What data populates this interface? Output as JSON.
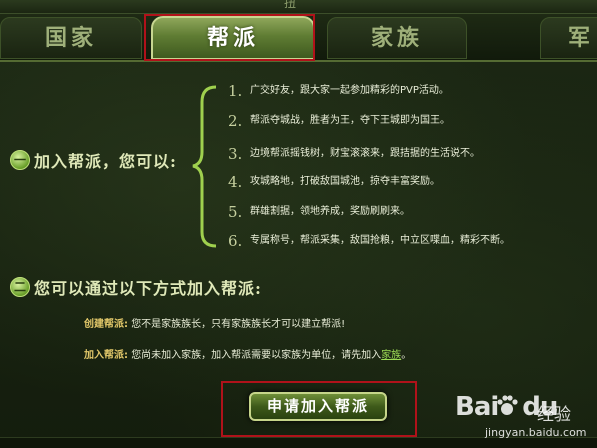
{
  "window": {
    "title": "扭"
  },
  "tabs": [
    {
      "label": "国家",
      "active": false
    },
    {
      "label": "帮派",
      "active": true
    },
    {
      "label": "家族",
      "active": false
    },
    {
      "label": "军",
      "active": false
    }
  ],
  "section1": {
    "title": "加入帮派，您可以:",
    "items": [
      {
        "num": "1.",
        "text": "广交好友，跟大家一起参加精彩的PVP活动。"
      },
      {
        "num": "2.",
        "text": "帮派夺城战，胜者为王，夺下王城即为国王。"
      },
      {
        "num": "3.",
        "text": "边境帮派摇钱树，财宝滚滚来，跟拮据的生活说不。"
      },
      {
        "num": "4.",
        "text": "攻城略地，打破敌国城池，掠夺丰富奖励。"
      },
      {
        "num": "5.",
        "text": "群雄割据，领地养成，奖励刷刷来。"
      },
      {
        "num": "6.",
        "text": "专属称号，帮派采集，敌国抢粮，中立区喋血，精彩不断。"
      }
    ]
  },
  "section2": {
    "title": "您可以通过以下方式加入帮派:",
    "create": {
      "label": "创建帮派:",
      "text": "您不是家族族长，只有家族族长才可以建立帮派!"
    },
    "join": {
      "label": "加入帮派:",
      "text": "您尚未加入家族，加入帮派需要以家族为单位，请先加入",
      "link": "家族",
      "end": "。"
    }
  },
  "apply_button": {
    "label": "申请加入帮派"
  },
  "watermark": {
    "logo": "Bai",
    "logo2": "du",
    "text": "经验",
    "url": "jingyan.baidu.com"
  },
  "colors": {
    "accent_green": "#9ddc56",
    "label_gold": "#e2c86a",
    "highlight_red": "#b0121a"
  }
}
